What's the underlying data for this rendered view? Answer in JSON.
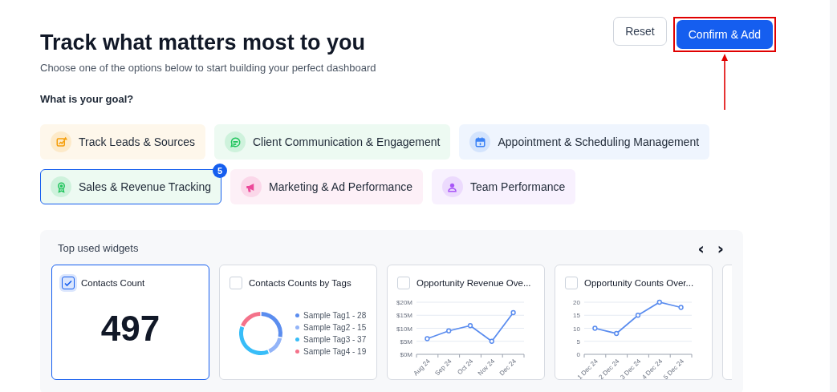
{
  "header": {
    "title": "Track what matters most to you",
    "subtitle": "Choose one of the options below to start building your perfect dashboard"
  },
  "actions": [
    {
      "label": "Reset",
      "kind": "secondary",
      "highlighted": false
    },
    {
      "label": "Confirm & Add",
      "kind": "primary",
      "highlighted": true
    }
  ],
  "goal_prompt": "What is your goal?",
  "goals": [
    {
      "label": "Track Leads & Sources",
      "color": "#f59e0b",
      "selected": false
    },
    {
      "label": "Client Communication & Engagement",
      "color": "#22c55e",
      "selected": false
    },
    {
      "label": "Appointment & Scheduling Management",
      "color": "#3b82f6",
      "selected": false
    },
    {
      "label": "Sales & Revenue Tracking",
      "color": "#22c55e",
      "selected": true,
      "badge": "5"
    },
    {
      "label": "Marketing & Ad Performance",
      "color": "#ec4899",
      "selected": false
    },
    {
      "label": "Team Performance",
      "color": "#a855f7",
      "selected": false
    }
  ],
  "widgets": {
    "title": "Top used widgets",
    "nav": [
      "‹",
      "›"
    ],
    "cards": [
      {
        "kind": "number",
        "title": "Contacts Count",
        "checked": true,
        "selected": true,
        "value": "497"
      },
      {
        "kind": "chart",
        "title": "Contacts Counts by Tags",
        "checked": false,
        "selected": false,
        "chart_data": {
          "type": "donut",
          "categories": [
            "Sample Tag1 - 28",
            "Sample Tag2 - 15",
            "Sample Tag3 - 37",
            "Sample Tag4 - 19"
          ],
          "values": [
            28,
            15,
            37,
            19
          ],
          "colors": [
            "#5b8def",
            "#93b4f8",
            "#38bdf8",
            "#f4728a"
          ]
        }
      },
      {
        "kind": "chart",
        "title": "Opportunity Revenue Ove...",
        "checked": false,
        "selected": false,
        "chart_data": {
          "type": "line",
          "grid": true,
          "categories": [
            "Aug 24",
            "Sep 24",
            "Oct 24",
            "Nov 24",
            "Dec 24"
          ],
          "series": [
            {
              "color": "#5b8def",
              "marker": true,
              "values": [
                6,
                9,
                11,
                5,
                16
              ]
            }
          ],
          "ylim": [
            0,
            20
          ],
          "yticks": [
            {
              "value": 0,
              "label": "$0M"
            },
            {
              "value": 5,
              "label": "$5M"
            },
            {
              "value": 10,
              "label": "$10M"
            },
            {
              "value": 15,
              "label": "$15M"
            },
            {
              "value": 20,
              "label": "$20M"
            }
          ]
        }
      },
      {
        "kind": "chart",
        "title": "Opportunity Counts Over...",
        "checked": false,
        "selected": false,
        "chart_data": {
          "type": "line",
          "grid": true,
          "categories": [
            "1 Dec 24",
            "2 Dec 24",
            "3 Dec 24",
            "4 Dec 24",
            "5 Dec 24"
          ],
          "series": [
            {
              "color": "#5b8def",
              "marker": true,
              "values": [
                10,
                8,
                15,
                20,
                18
              ]
            }
          ],
          "ylim": [
            0,
            20
          ],
          "yticks": [
            0,
            5,
            10,
            15,
            20
          ]
        }
      },
      {
        "kind": "blank"
      }
    ]
  }
}
